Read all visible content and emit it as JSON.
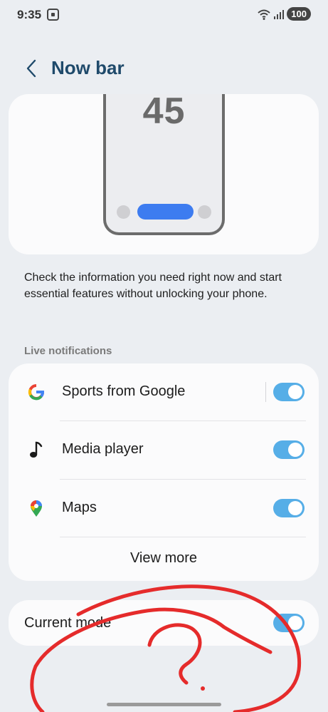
{
  "status_bar": {
    "time": "9:35",
    "battery": "100",
    "icons": [
      "screen-record-icon",
      "wifi-icon",
      "signal-icon",
      "battery-icon"
    ]
  },
  "header": {
    "title": "Now bar",
    "back_icon": "chevron-left-icon"
  },
  "preview": {
    "clock": "45",
    "pill_color": "#3d7cf0"
  },
  "description": "Check the information you need right now and start essential features without unlocking your phone.",
  "live_notifications": {
    "header": "Live notifications",
    "items": [
      {
        "label": "Sports from Google",
        "icon": "google-icon",
        "enabled": true
      },
      {
        "label": "Media player",
        "icon": "music-note-icon",
        "enabled": true
      },
      {
        "label": "Maps",
        "icon": "maps-pin-icon",
        "enabled": true
      }
    ],
    "view_more": "View more"
  },
  "current_mode": {
    "label": "Current mode",
    "enabled": true
  },
  "colors": {
    "background": "#ebeef2",
    "card": "#fbfbfc",
    "title": "#1f4a6b",
    "toggle_on": "#56aee7",
    "annotation": "#e52b2b"
  }
}
